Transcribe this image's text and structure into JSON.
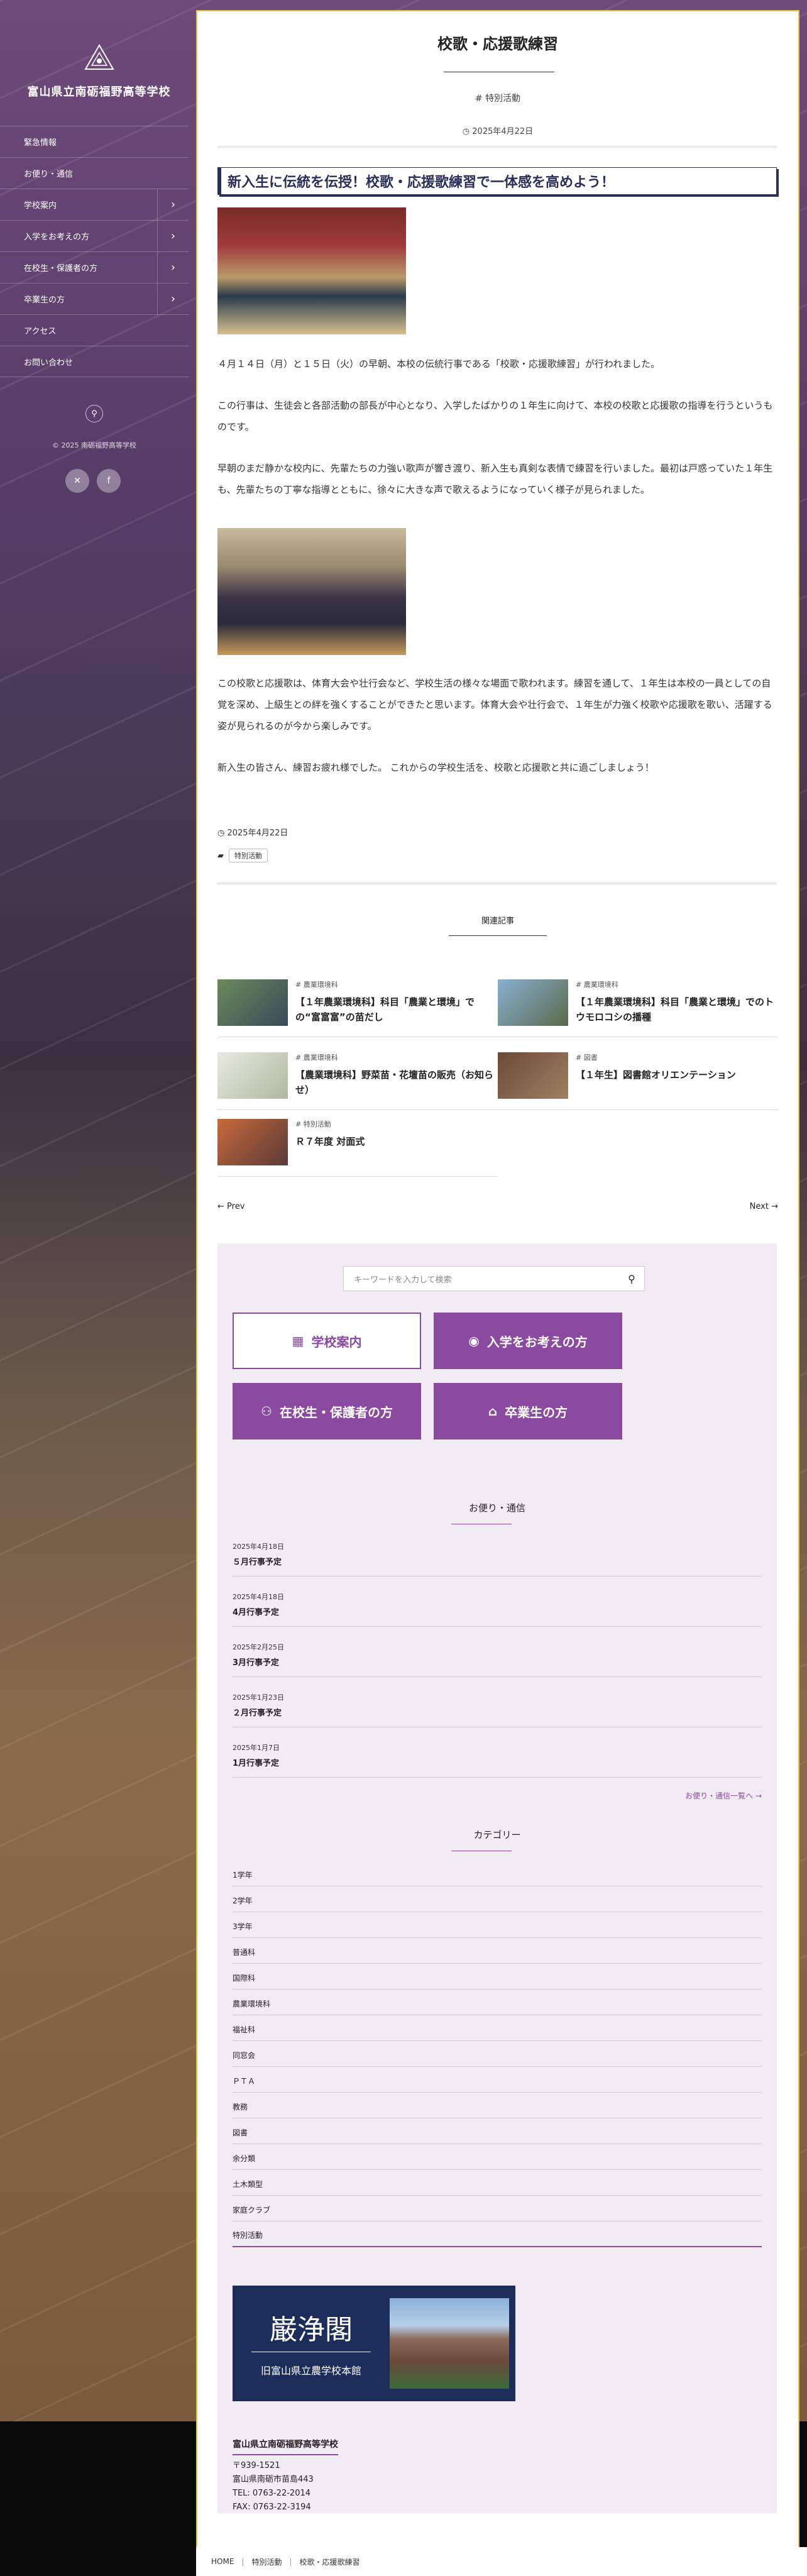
{
  "site": {
    "school_name": "富山県立南砺福野高等学校",
    "copyright": "© 2025 南砺福野高等学校"
  },
  "nav": {
    "items": [
      {
        "label": "緊急情報",
        "has_sub": false
      },
      {
        "label": "お便り・通信",
        "has_sub": false
      },
      {
        "label": "学校案内",
        "has_sub": true
      },
      {
        "label": "入学をお考えの方",
        "has_sub": true
      },
      {
        "label": "在校生・保護者の方",
        "has_sub": true
      },
      {
        "label": "卒業生の方",
        "has_sub": true
      },
      {
        "label": "アクセス",
        "has_sub": false
      },
      {
        "label": "お問い合わせ",
        "has_sub": false
      }
    ]
  },
  "article": {
    "title": "校歌・応援歌練習",
    "category": "# 特別活動",
    "date": "2025年4月22日",
    "headline": "新入生に伝統を伝授！校歌・応援歌練習で一体感を高めよう！",
    "paragraphs": [
      "４月１４日（月）と１５日（火）の早朝、本校の伝統行事である「校歌・応援歌練習」が行われました。",
      "この行事は、生徒会と各部活動の部長が中心となり、入学したばかりの１年生に向けて、本校の校歌と応援歌の指導を行うというものです。",
      "早朝のまだ静かな校内に、先輩たちの力強い歌声が響き渡り、新入生も真剣な表情で練習を行いました。最初は戸惑っていた１年生も、先輩たちの丁寧な指導とともに、徐々に大きな声で歌えるようになっていく様子が見られました。",
      "この校歌と応援歌は、体育大会や壮行会など、学校生活の様々な場面で歌われます。練習を通して、１年生は本校の一員としての自覚を深め、上級生との絆を強くすることができたと思います。体育大会や壮行会で、１年生が力強く校歌や応援歌を歌い、活躍する姿が見られるのが今から楽しみです。",
      "新入生の皆さん、練習お疲れ様でした。 これからの学校生活を、校歌と応援歌と共に過ごしましょう！"
    ],
    "footer_date": "2025年4月22日",
    "tag": "特別活動"
  },
  "related": {
    "heading": "関連記事",
    "items": [
      {
        "category": "# 農業環境科",
        "title": "【１年農業環境科】科目「農業と環境」での“富富富”の苗だし"
      },
      {
        "category": "# 農業環境科",
        "title": "【１年農業環境科】科目「農業と環境」でのトウモロコシの播種"
      },
      {
        "category": "# 農業環境科",
        "title": "【農業環境科】野菜苗・花壇苗の販売（お知らせ）"
      },
      {
        "category": "# 図書",
        "title": "【１年生】図書館オリエンテーション"
      },
      {
        "category": "# 特別活動",
        "title": "Ｒ７年度 対面式"
      }
    ],
    "prev": "Prev",
    "next": "Next"
  },
  "widget": {
    "search_placeholder": "キーワードを入力して検索",
    "buttons": [
      "学校案内",
      "入学をお考えの方",
      "在校生・保護者の方",
      "卒業生の方"
    ],
    "news_heading": "お便り・通信",
    "news": [
      {
        "date": "2025年4月18日",
        "title": "５月行事予定"
      },
      {
        "date": "2025年4月18日",
        "title": "4月行事予定"
      },
      {
        "date": "2025年2月25日",
        "title": "3月行事予定"
      },
      {
        "date": "2025年1月23日",
        "title": "２月行事予定"
      },
      {
        "date": "2025年1月7日",
        "title": "1月行事予定"
      }
    ],
    "news_more": "お便り・通信一覧へ →",
    "category_heading": "カテゴリー",
    "categories": [
      "1学年",
      "2学年",
      "3学年",
      "普通科",
      "国際科",
      "農業環境科",
      "福祉科",
      "同窓会",
      "ＰＴＡ",
      "教務",
      "図書",
      "余分類",
      "土木類型",
      "家庭クラブ",
      "特別活動"
    ],
    "banner_title": "巌浄閣",
    "banner_sub": "旧富山県立農学校本館",
    "address": {
      "name": "富山県立南砺福野高等学校",
      "zip": "〒939-1521",
      "street": "富山県南砺市苗島443",
      "tel": "TEL: 0763-22-2014",
      "fax": "FAX: 0763-22-3194"
    }
  },
  "breadcrumb": [
    "HOME",
    "特別活動",
    "校歌・応援歌練習"
  ],
  "colors": {
    "accent": "#8a4aa0",
    "navy": "#2a2f5a",
    "frame": "#e8c34a"
  }
}
